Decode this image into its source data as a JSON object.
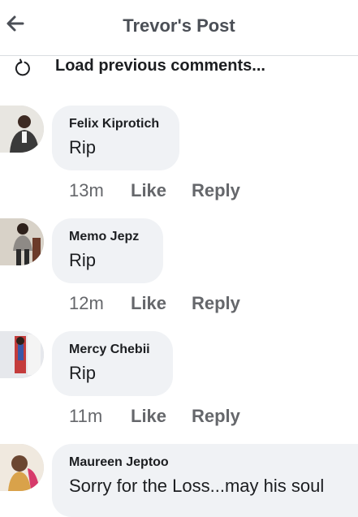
{
  "header": {
    "title": "Trevor's Post",
    "back_icon": "arrow-left-icon"
  },
  "load_previous": {
    "label": "Load previous comments...",
    "icon": "reload-icon"
  },
  "comments": [
    {
      "author": "Felix Kiprotich",
      "text": "Rip",
      "time": "13m",
      "like": "Like",
      "reply": "Reply"
    },
    {
      "author": "Memo Jepz",
      "text": "Rip",
      "time": "12m",
      "like": "Like",
      "reply": "Reply"
    },
    {
      "author": "Mercy Chebii",
      "text": "Rip",
      "time": "11m",
      "like": "Like",
      "reply": "Reply"
    },
    {
      "author": "Maureen Jeptoo",
      "text": "Sorry for the Loss...may his soul"
    }
  ],
  "colors": {
    "bubble": "#f0f2f5",
    "muted": "#65676b",
    "title": "#4b4f56"
  }
}
